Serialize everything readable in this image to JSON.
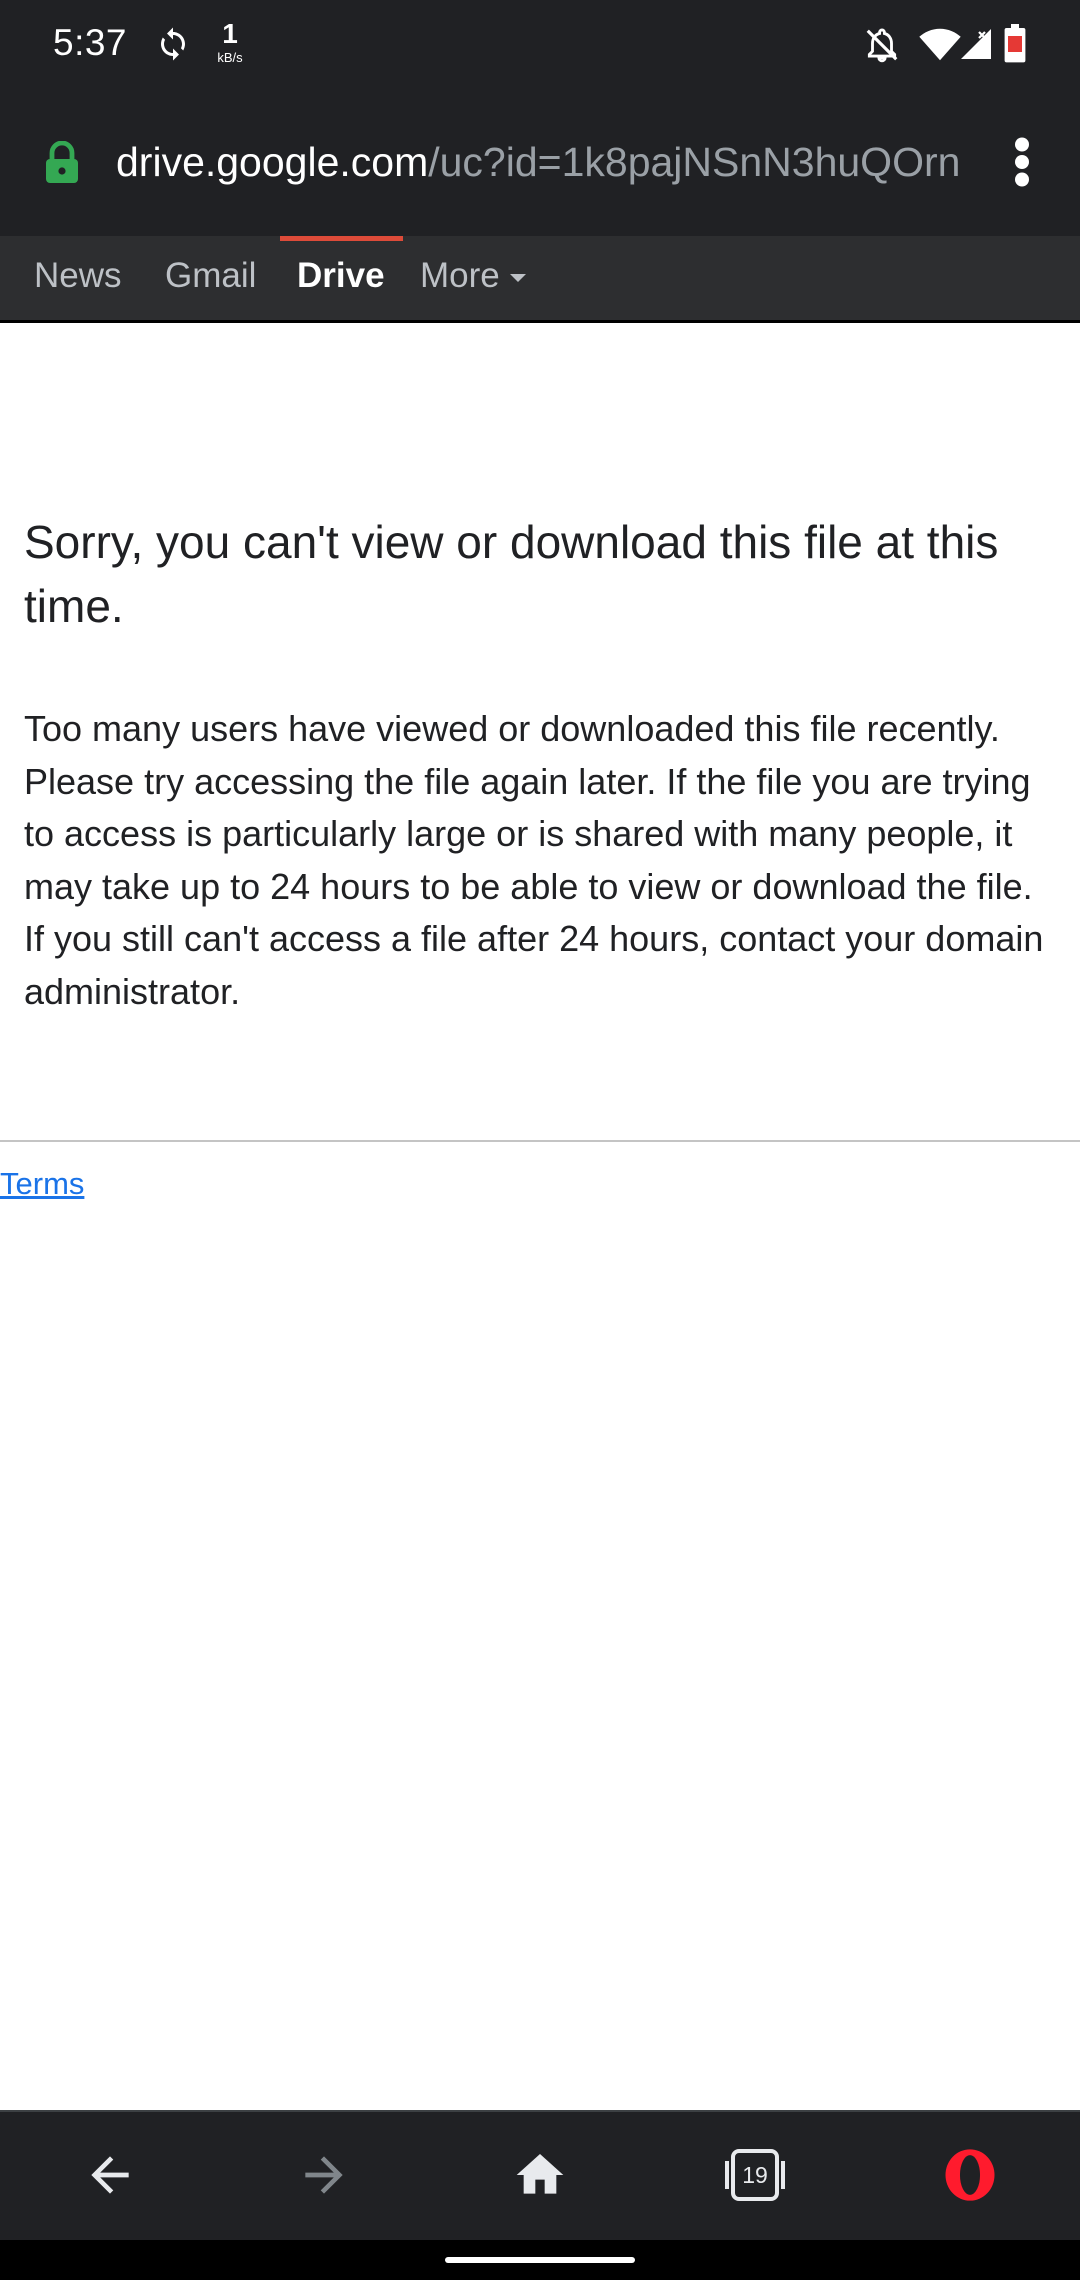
{
  "status_bar": {
    "time": "5:37",
    "net_speed_value": "1",
    "net_speed_unit": "kB/s",
    "battery_color": "#e53935",
    "icons": [
      "sync-icon",
      "notifications-off-icon",
      "wifi-icon",
      "signal-icon",
      "battery-icon"
    ]
  },
  "url_bar": {
    "domain": "drive.google.com",
    "path": "/uc?id=1k8pajNSnN3huQOrn",
    "lock_color": "#34a853"
  },
  "google_bar": {
    "items": [
      {
        "label": "News",
        "active": false
      },
      {
        "label": "Gmail",
        "active": false
      },
      {
        "label": "Drive",
        "active": true
      },
      {
        "label": "More",
        "active": false
      }
    ],
    "active_color": "#dd4b39"
  },
  "main": {
    "title": "Sorry, you can't view or download this file at this time.",
    "body": "Too many users have viewed or downloaded this file recently. Please try accessing the file again later. If the file you are trying to access is particularly large or is shared with many people, it may take up to 24 hours to be able to view or download the file. If you still can't access a file after 24 hours, contact your domain administrator."
  },
  "footer": {
    "terms_label": "Terms",
    "link_color": "#1a73e8"
  },
  "bottom_nav": {
    "tabs_count": "19",
    "opera_color": "#ff1b2d",
    "buttons": [
      "back-icon",
      "forward-icon",
      "home-icon",
      "tabs-icon",
      "opera-menu-icon"
    ]
  }
}
